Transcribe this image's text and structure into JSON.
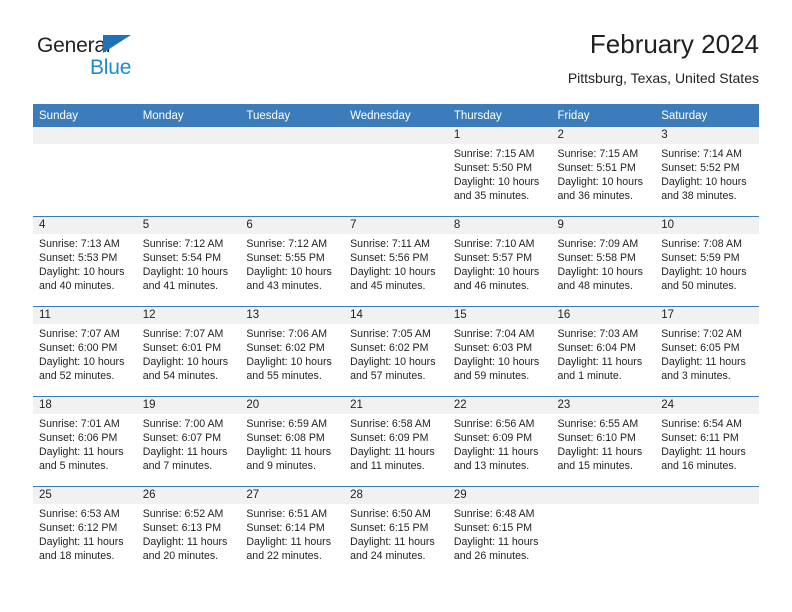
{
  "logo": {
    "word_one": "General",
    "word_two": "Blue",
    "triangle_color": "#1f71b8",
    "blue_color": "#1f8ad6"
  },
  "header": {
    "title": "February 2024",
    "subtitle": "Pittsburg, Texas, United States"
  },
  "theme": {
    "header_blue": "#3c7cba",
    "daynum_band": "#f1f1f1",
    "text": "#231f20"
  },
  "calendar": {
    "weekday_headers": [
      "Sunday",
      "Monday",
      "Tuesday",
      "Wednesday",
      "Thursday",
      "Friday",
      "Saturday"
    ],
    "weeks": [
      [
        {
          "day": "",
          "sunrise": "",
          "sunset": "",
          "daylight": "",
          "empty": true
        },
        {
          "day": "",
          "sunrise": "",
          "sunset": "",
          "daylight": "",
          "empty": true
        },
        {
          "day": "",
          "sunrise": "",
          "sunset": "",
          "daylight": "",
          "empty": true
        },
        {
          "day": "",
          "sunrise": "",
          "sunset": "",
          "daylight": "",
          "empty": true
        },
        {
          "day": "1",
          "sunrise": "Sunrise: 7:15 AM",
          "sunset": "Sunset: 5:50 PM",
          "daylight": "Daylight: 10 hours and 35 minutes."
        },
        {
          "day": "2",
          "sunrise": "Sunrise: 7:15 AM",
          "sunset": "Sunset: 5:51 PM",
          "daylight": "Daylight: 10 hours and 36 minutes."
        },
        {
          "day": "3",
          "sunrise": "Sunrise: 7:14 AM",
          "sunset": "Sunset: 5:52 PM",
          "daylight": "Daylight: 10 hours and 38 minutes."
        }
      ],
      [
        {
          "day": "4",
          "sunrise": "Sunrise: 7:13 AM",
          "sunset": "Sunset: 5:53 PM",
          "daylight": "Daylight: 10 hours and 40 minutes."
        },
        {
          "day": "5",
          "sunrise": "Sunrise: 7:12 AM",
          "sunset": "Sunset: 5:54 PM",
          "daylight": "Daylight: 10 hours and 41 minutes."
        },
        {
          "day": "6",
          "sunrise": "Sunrise: 7:12 AM",
          "sunset": "Sunset: 5:55 PM",
          "daylight": "Daylight: 10 hours and 43 minutes."
        },
        {
          "day": "7",
          "sunrise": "Sunrise: 7:11 AM",
          "sunset": "Sunset: 5:56 PM",
          "daylight": "Daylight: 10 hours and 45 minutes."
        },
        {
          "day": "8",
          "sunrise": "Sunrise: 7:10 AM",
          "sunset": "Sunset: 5:57 PM",
          "daylight": "Daylight: 10 hours and 46 minutes."
        },
        {
          "day": "9",
          "sunrise": "Sunrise: 7:09 AM",
          "sunset": "Sunset: 5:58 PM",
          "daylight": "Daylight: 10 hours and 48 minutes."
        },
        {
          "day": "10",
          "sunrise": "Sunrise: 7:08 AM",
          "sunset": "Sunset: 5:59 PM",
          "daylight": "Daylight: 10 hours and 50 minutes."
        }
      ],
      [
        {
          "day": "11",
          "sunrise": "Sunrise: 7:07 AM",
          "sunset": "Sunset: 6:00 PM",
          "daylight": "Daylight: 10 hours and 52 minutes."
        },
        {
          "day": "12",
          "sunrise": "Sunrise: 7:07 AM",
          "sunset": "Sunset: 6:01 PM",
          "daylight": "Daylight: 10 hours and 54 minutes."
        },
        {
          "day": "13",
          "sunrise": "Sunrise: 7:06 AM",
          "sunset": "Sunset: 6:02 PM",
          "daylight": "Daylight: 10 hours and 55 minutes."
        },
        {
          "day": "14",
          "sunrise": "Sunrise: 7:05 AM",
          "sunset": "Sunset: 6:02 PM",
          "daylight": "Daylight: 10 hours and 57 minutes."
        },
        {
          "day": "15",
          "sunrise": "Sunrise: 7:04 AM",
          "sunset": "Sunset: 6:03 PM",
          "daylight": "Daylight: 10 hours and 59 minutes."
        },
        {
          "day": "16",
          "sunrise": "Sunrise: 7:03 AM",
          "sunset": "Sunset: 6:04 PM",
          "daylight": "Daylight: 11 hours and 1 minute."
        },
        {
          "day": "17",
          "sunrise": "Sunrise: 7:02 AM",
          "sunset": "Sunset: 6:05 PM",
          "daylight": "Daylight: 11 hours and 3 minutes."
        }
      ],
      [
        {
          "day": "18",
          "sunrise": "Sunrise: 7:01 AM",
          "sunset": "Sunset: 6:06 PM",
          "daylight": "Daylight: 11 hours and 5 minutes."
        },
        {
          "day": "19",
          "sunrise": "Sunrise: 7:00 AM",
          "sunset": "Sunset: 6:07 PM",
          "daylight": "Daylight: 11 hours and 7 minutes."
        },
        {
          "day": "20",
          "sunrise": "Sunrise: 6:59 AM",
          "sunset": "Sunset: 6:08 PM",
          "daylight": "Daylight: 11 hours and 9 minutes."
        },
        {
          "day": "21",
          "sunrise": "Sunrise: 6:58 AM",
          "sunset": "Sunset: 6:09 PM",
          "daylight": "Daylight: 11 hours and 11 minutes."
        },
        {
          "day": "22",
          "sunrise": "Sunrise: 6:56 AM",
          "sunset": "Sunset: 6:09 PM",
          "daylight": "Daylight: 11 hours and 13 minutes."
        },
        {
          "day": "23",
          "sunrise": "Sunrise: 6:55 AM",
          "sunset": "Sunset: 6:10 PM",
          "daylight": "Daylight: 11 hours and 15 minutes."
        },
        {
          "day": "24",
          "sunrise": "Sunrise: 6:54 AM",
          "sunset": "Sunset: 6:11 PM",
          "daylight": "Daylight: 11 hours and 16 minutes."
        }
      ],
      [
        {
          "day": "25",
          "sunrise": "Sunrise: 6:53 AM",
          "sunset": "Sunset: 6:12 PM",
          "daylight": "Daylight: 11 hours and 18 minutes."
        },
        {
          "day": "26",
          "sunrise": "Sunrise: 6:52 AM",
          "sunset": "Sunset: 6:13 PM",
          "daylight": "Daylight: 11 hours and 20 minutes."
        },
        {
          "day": "27",
          "sunrise": "Sunrise: 6:51 AM",
          "sunset": "Sunset: 6:14 PM",
          "daylight": "Daylight: 11 hours and 22 minutes."
        },
        {
          "day": "28",
          "sunrise": "Sunrise: 6:50 AM",
          "sunset": "Sunset: 6:15 PM",
          "daylight": "Daylight: 11 hours and 24 minutes."
        },
        {
          "day": "29",
          "sunrise": "Sunrise: 6:48 AM",
          "sunset": "Sunset: 6:15 PM",
          "daylight": "Daylight: 11 hours and 26 minutes."
        },
        {
          "day": "",
          "sunrise": "",
          "sunset": "",
          "daylight": "",
          "empty": true
        },
        {
          "day": "",
          "sunrise": "",
          "sunset": "",
          "daylight": "",
          "empty": true
        }
      ]
    ]
  }
}
